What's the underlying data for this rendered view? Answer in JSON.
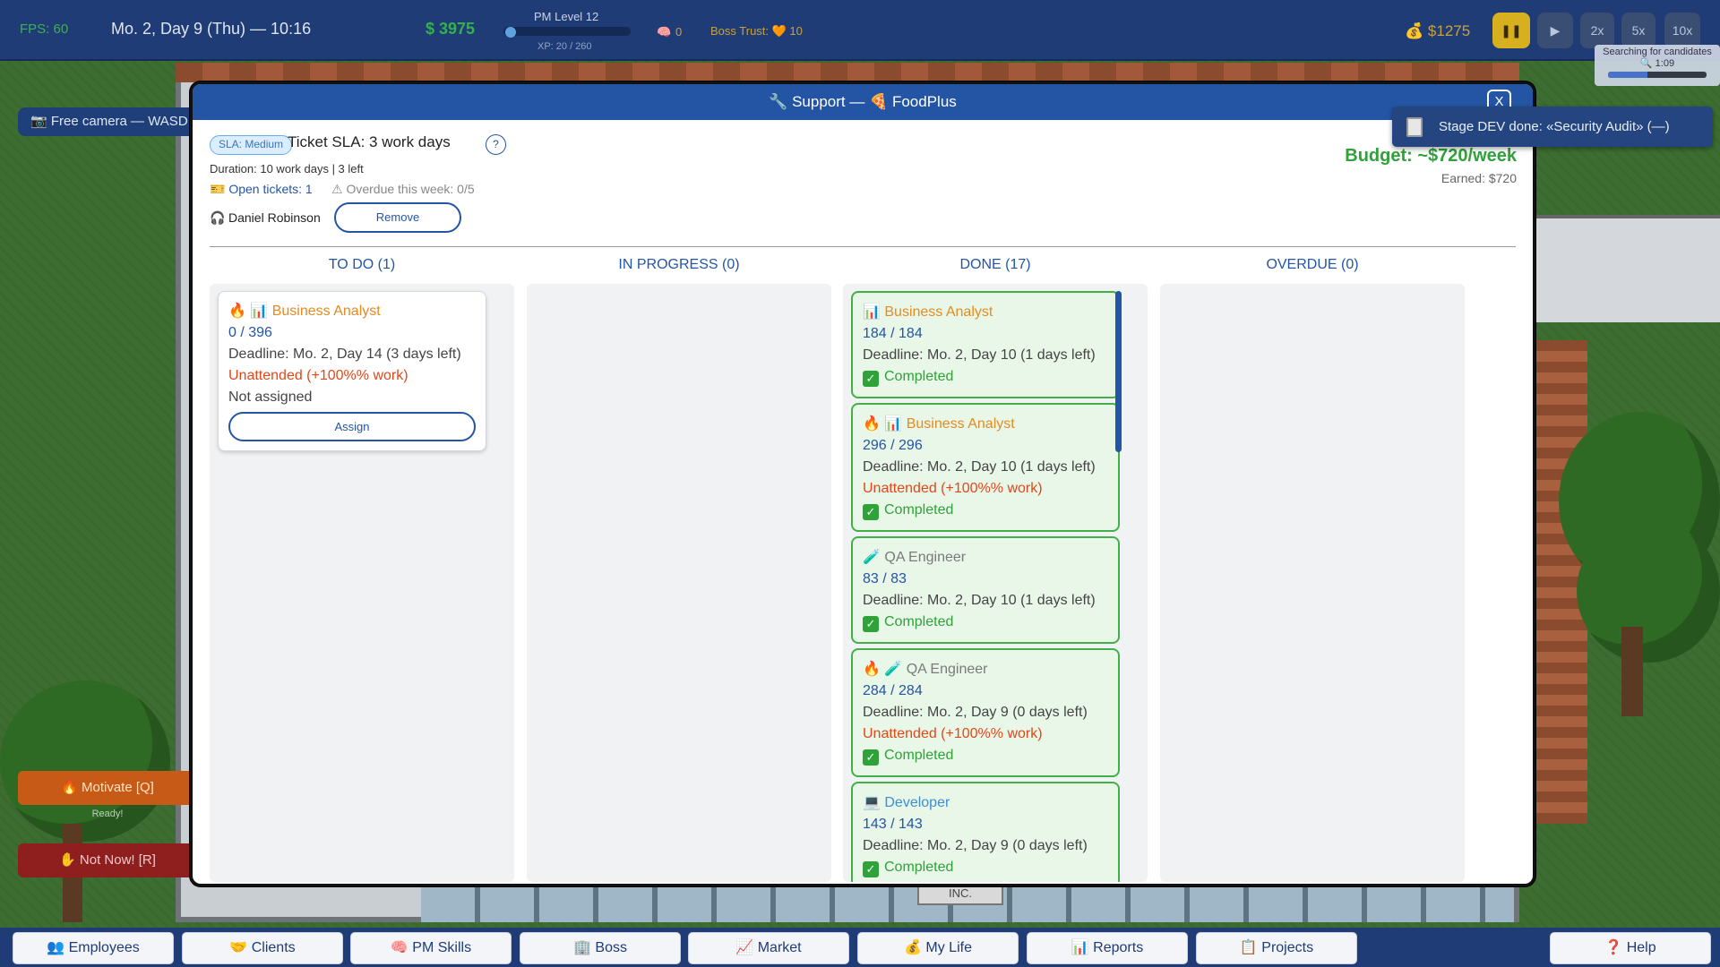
{
  "hud": {
    "fps": "FPS: 60",
    "date": "Mo. 2, Day 9 (Thu) — 10:16",
    "money": "$ 3975",
    "pm_level": "PM Level 12",
    "xp": "XP: 20 / 260",
    "brain_value": "0",
    "boss_trust": "Boss Trust: 🧡 10",
    "cash": "$1275",
    "speed_buttons": [
      "2x",
      "5x",
      "10x"
    ],
    "search_text": "Searching for candidates",
    "search_time": "🔍 1:09",
    "search_progress": 0.4
  },
  "world": {
    "free_camera": "📷 Free camera — WASD",
    "motivate": "🔥 Motivate [Q]",
    "ready": "Ready!",
    "not_now": "✋ Not Now! [R]",
    "inc_sign": "INC."
  },
  "toast": {
    "text": "Stage DEV done: «Security Audit» (—)"
  },
  "modal": {
    "title": "🔧 Support — 🍕 FoodPlus",
    "close": "X",
    "sla_badge": "SLA: Medium",
    "sla_title": "Ticket SLA: 3 work days",
    "help": "?",
    "duration": "Duration: 10 work days | 3 left",
    "open_tickets": "🎫 Open tickets: 1",
    "overdue_week": "⚠ Overdue this week: 0/5",
    "agent": "Daniel Robinson",
    "remove": "Remove",
    "budget": "Budget: ~$720/week",
    "earned": "Earned: $720",
    "columns": {
      "todo": "TO DO (1)",
      "in_progress": "IN PROGRESS (0)",
      "done": "DONE (17)",
      "overdue": "OVERDUE (0)"
    },
    "todo_cards": [
      {
        "role": "🔥 📊 Business Analyst",
        "progress": "0 / 396",
        "deadline": "Deadline: Mo. 2, Day 14 (3 days left)",
        "warning": "Unattended (+100%% work)",
        "status": "Not assigned",
        "assign": "Assign"
      }
    ],
    "done_cards": [
      {
        "role": "📊 Business Analyst",
        "progress": "184 / 184",
        "deadline": "Deadline: Mo. 2, Day 10 (1 days left)",
        "status": "Completed"
      },
      {
        "role": "🔥 📊 Business Analyst",
        "progress": "296 / 296",
        "deadline": "Deadline: Mo. 2, Day 10 (1 days left)",
        "warning": "Unattended (+100%% work)",
        "status": "Completed"
      },
      {
        "role": "🧪 QA Engineer",
        "progress": "83 / 83",
        "deadline": "Deadline: Mo. 2, Day 10 (1 days left)",
        "status": "Completed"
      },
      {
        "role": "🔥 🧪 QA Engineer",
        "progress": "284 / 284",
        "deadline": "Deadline: Mo. 2, Day 9 (0 days left)",
        "warning": "Unattended (+100%% work)",
        "status": "Completed"
      },
      {
        "role": "💻 Developer",
        "progress": "143 / 143",
        "deadline": "Deadline: Mo. 2, Day 9 (0 days left)",
        "status": "Completed"
      }
    ]
  },
  "nav": [
    "👥 Employees",
    "🤝 Clients",
    "🧠 PM Skills",
    "🏢 Boss",
    "📈 Market",
    "💰 My Life",
    "📊 Reports",
    "📋 Projects",
    "❓ Help"
  ]
}
